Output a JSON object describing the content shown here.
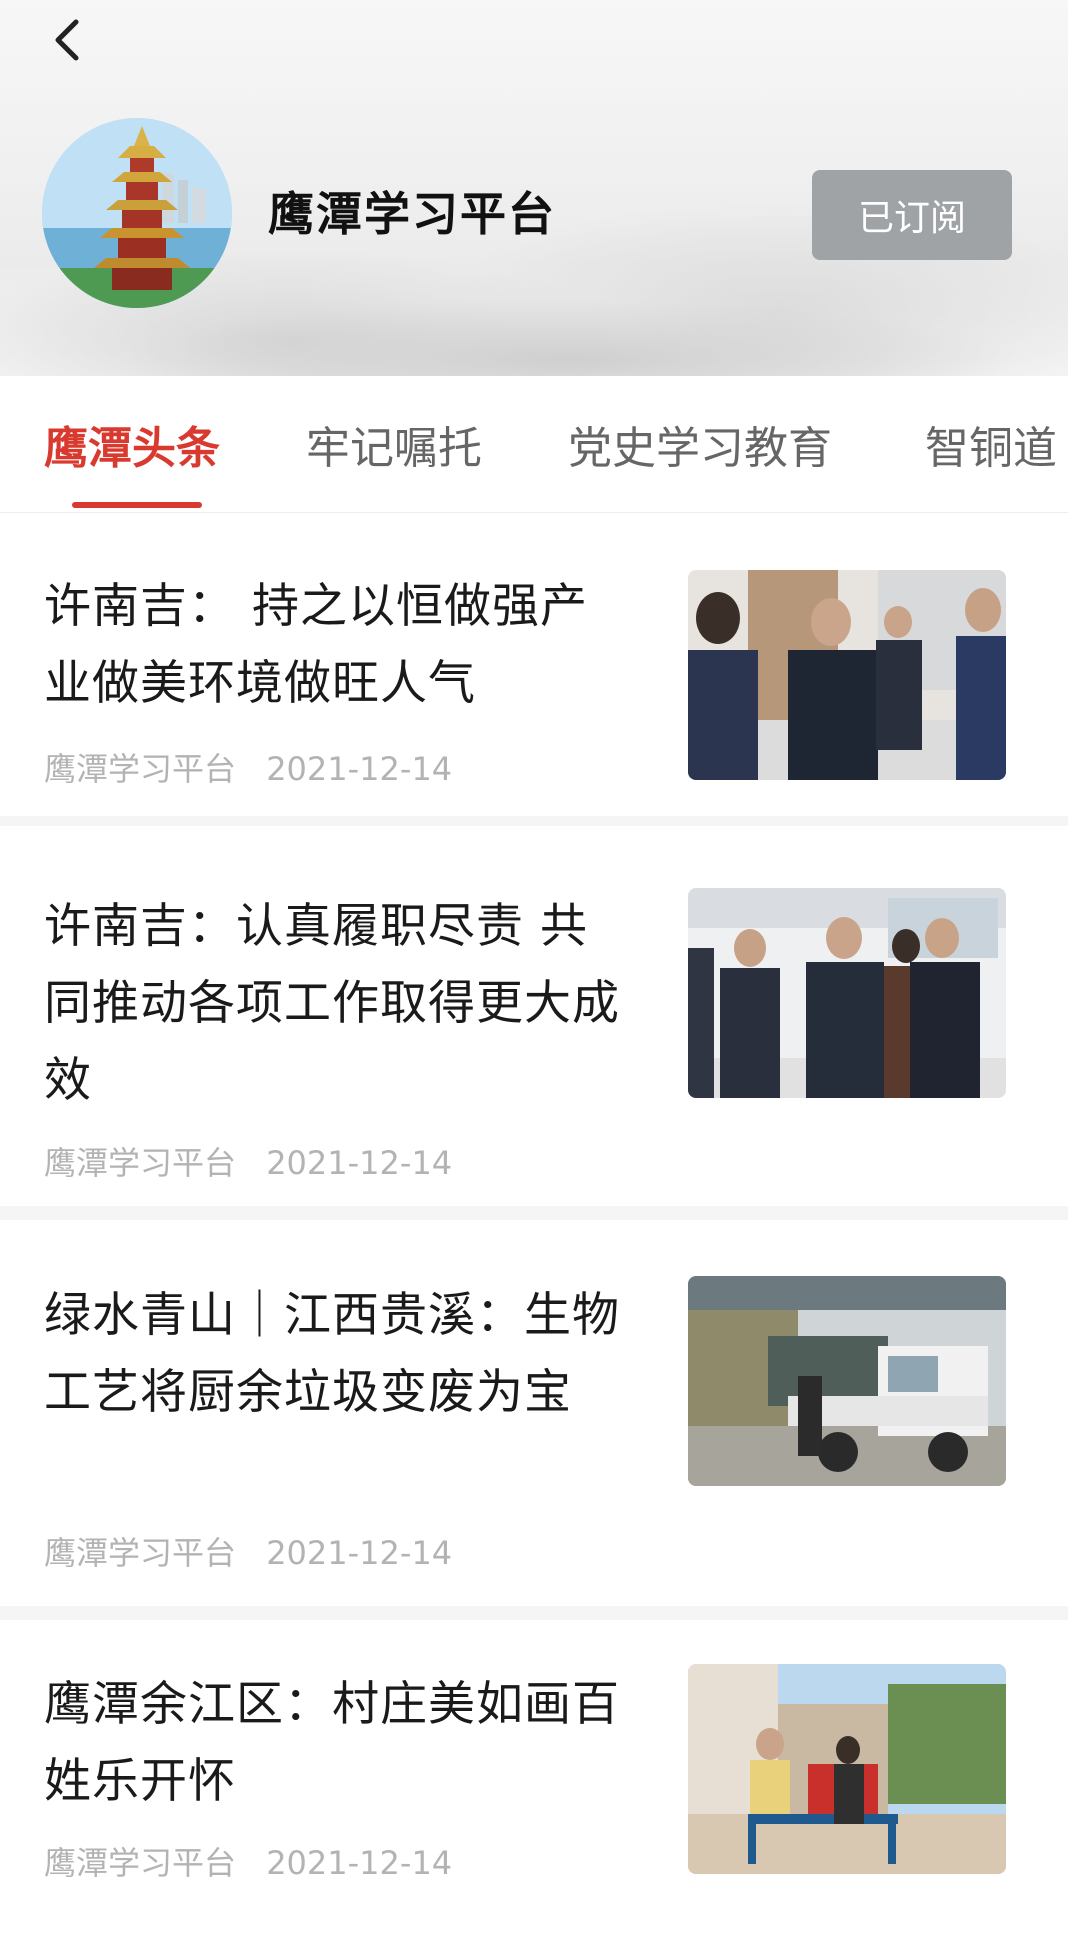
{
  "header": {
    "title": "鹰潭学习平台",
    "subscribe_label": "已订阅",
    "icons": {
      "back": "chevron-left-icon"
    }
  },
  "tabs": [
    {
      "label": "鹰潭头条",
      "active": true
    },
    {
      "label": "牢记嘱托",
      "active": false
    },
    {
      "label": "党史学习教育",
      "active": false
    },
    {
      "label": "智铜道",
      "active": false
    }
  ],
  "articles": [
    {
      "title": "许南吉： 持之以恒做强产业做美环境做旺人气",
      "source": "鹰潭学习平台",
      "date": "2021-12-14"
    },
    {
      "title": "许南吉：认真履职尽责 共同推动各项工作取得更大成效",
      "source": "鹰潭学习平台",
      "date": "2021-12-14"
    },
    {
      "title": "绿水青山｜江西贵溪：生物工艺将厨余垃圾变废为宝",
      "source": "鹰潭学习平台",
      "date": "2021-12-14"
    },
    {
      "title": "鹰潭余江区：村庄美如画百姓乐开怀",
      "source": "鹰潭学习平台",
      "date": "2021-12-14"
    }
  ],
  "colors": {
    "accent": "#d93a2f",
    "subscribed_bg": "#9fa3a6",
    "meta_text": "#b3b3b3"
  }
}
